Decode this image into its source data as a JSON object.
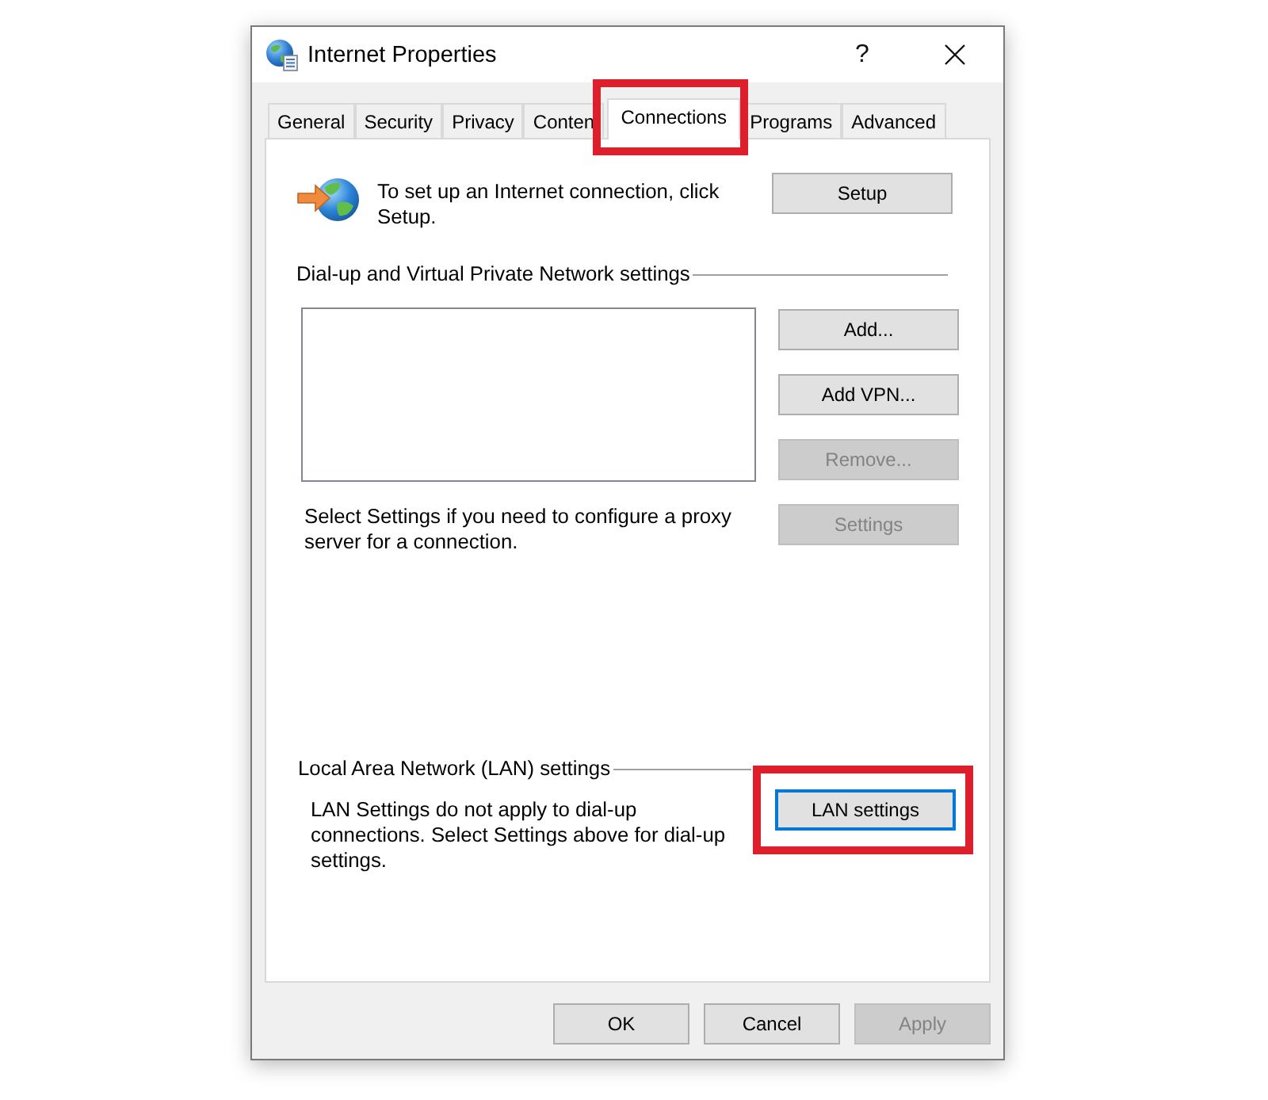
{
  "window": {
    "title": "Internet Properties",
    "help_button": "?"
  },
  "tabs": [
    {
      "label": "General",
      "selected": false,
      "highlighted": false
    },
    {
      "label": "Security",
      "selected": false,
      "highlighted": false
    },
    {
      "label": "Privacy",
      "selected": false,
      "highlighted": false
    },
    {
      "label": "Conten",
      "selected": false,
      "highlighted": false
    },
    {
      "label": "Connections",
      "selected": true,
      "highlighted": true
    },
    {
      "label": "Programs",
      "selected": false,
      "highlighted": false
    },
    {
      "label": "Advanced",
      "selected": false,
      "highlighted": false
    }
  ],
  "setup": {
    "text": "To set up an Internet connection, click Setup.",
    "button": {
      "label": "Setup",
      "disabled": false
    }
  },
  "dialup": {
    "heading": "Dial-up and Virtual Private Network settings",
    "buttons": [
      {
        "label": "Add...",
        "disabled": false
      },
      {
        "label": "Add VPN...",
        "disabled": false
      },
      {
        "label": "Remove...",
        "disabled": true
      },
      {
        "label": "Settings",
        "disabled": true
      }
    ],
    "proxy_text": "Select Settings if you need to configure a proxy server for a connection."
  },
  "lan": {
    "heading": "Local Area Network (LAN) settings",
    "text": "LAN Settings do not apply to dial-up connections. Select Settings above for dial-up settings.",
    "button": {
      "label": "LAN settings",
      "disabled": false,
      "focused": true,
      "highlighted": true
    }
  },
  "footer_buttons": [
    {
      "label": "OK",
      "disabled": false
    },
    {
      "label": "Cancel",
      "disabled": false
    },
    {
      "label": "Apply",
      "disabled": true
    }
  ]
}
